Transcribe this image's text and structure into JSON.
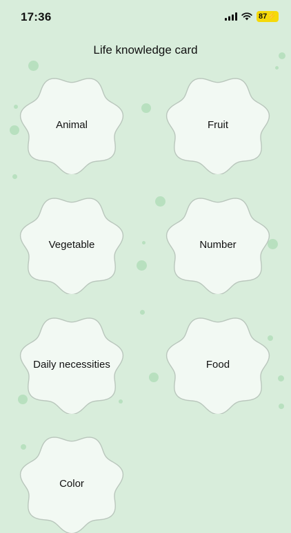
{
  "status_bar": {
    "time": "17:36",
    "battery": "87"
  },
  "page": {
    "title": "Life knowledge card"
  },
  "cards": [
    {
      "label": "Animal"
    },
    {
      "label": "Fruit"
    },
    {
      "label": "Vegetable"
    },
    {
      "label": "Number"
    },
    {
      "label": "Daily necessities"
    },
    {
      "label": "Food"
    },
    {
      "label": "Color"
    }
  ],
  "colors": {
    "background": "#d8eddb",
    "card_fill": "#f2f9f3",
    "card_outline": "#b9c6bc",
    "battery": "#f5d90a",
    "dots": "#b8e0bf"
  }
}
